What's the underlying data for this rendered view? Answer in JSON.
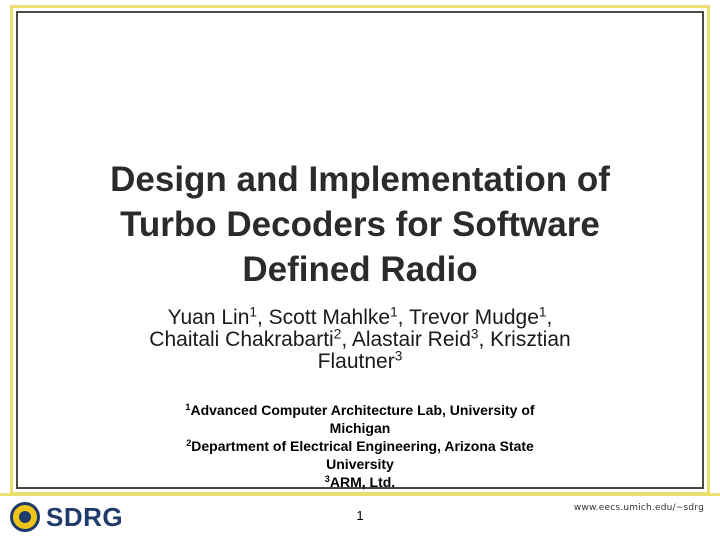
{
  "title": {
    "line1": "Design and Implementation of",
    "line2": "Turbo Decoders for Software",
    "line3": "Defined Radio"
  },
  "authors": {
    "a1": "Yuan Lin",
    "a1_sup": "1",
    "a2": "Scott Mahlke",
    "a2_sup": "1",
    "a3": "Trevor Mudge",
    "a3_sup": "1",
    "a4": "Chaitali Chakrabarti",
    "a4_sup": "2",
    "a5": "Alastair Reid",
    "a5_sup": "3",
    "a6_line1": "Krisztian",
    "a6_line2": "Flautner",
    "a6_sup": "3"
  },
  "affiliations": {
    "aff1_sup": "1",
    "aff1_line1": "Advanced Computer Architecture Lab, University of",
    "aff1_line2": "Michigan",
    "aff2_sup": "2",
    "aff2_line1": "Department of Electrical Engineering, Arizona State",
    "aff2_line2": "University",
    "aff3_sup": "3",
    "aff3": "ARM, Ltd."
  },
  "footer": {
    "brand": "SDRG",
    "page_number": "1",
    "url": "www.eecs.umich.edu/~sdrg"
  },
  "colors": {
    "frame_accent": "#e9df6e",
    "brand_navy": "#1f3b6b",
    "seal_gold": "#f0c419"
  }
}
